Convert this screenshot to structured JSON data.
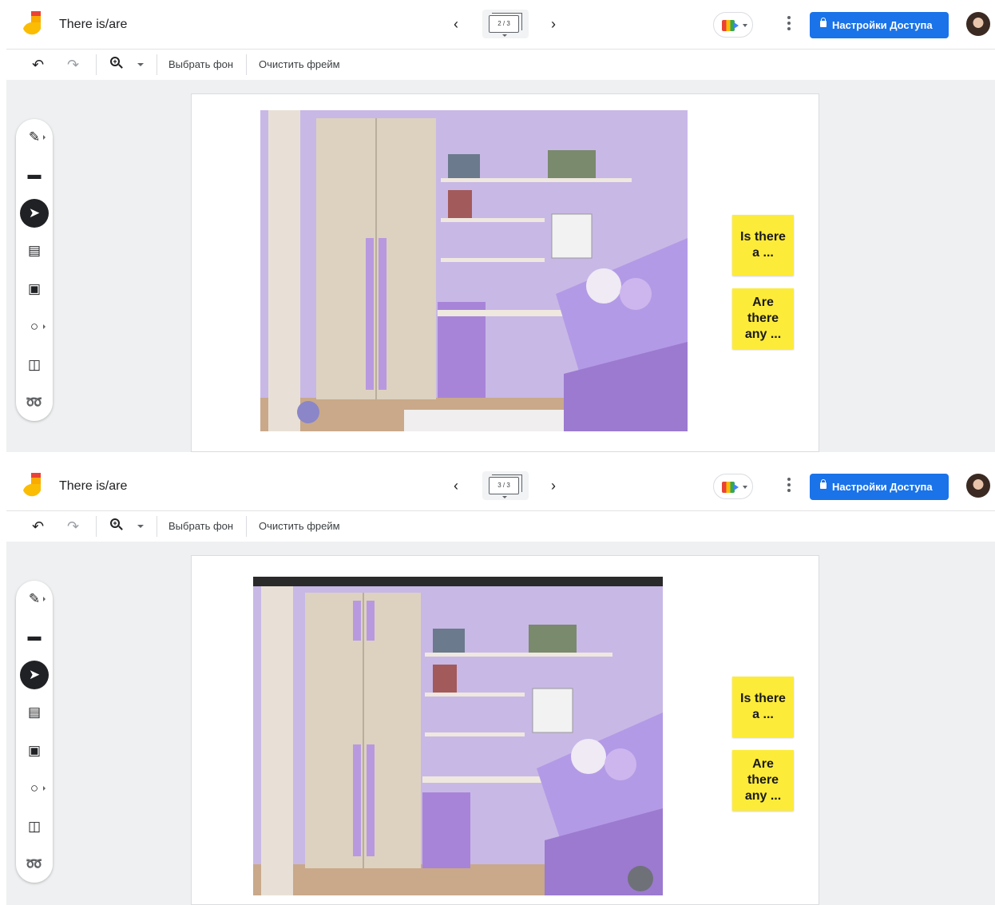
{
  "panels": [
    {
      "header": {
        "title": "There is/are",
        "frame_indicator": "2 / 3",
        "share_label": "Настройки Доступа"
      },
      "toolbar": {
        "choose_background": "Выбрать фон",
        "clear_frame": "Очистить фрейм"
      },
      "stickies": [
        "Is there a ...",
        "Are there any ..."
      ]
    },
    {
      "header": {
        "title": "There is/are",
        "frame_indicator": "3 / 3",
        "share_label": "Настройки Доступа"
      },
      "toolbar": {
        "choose_background": "Выбрать фон",
        "clear_frame": "Очистить фрейм"
      },
      "stickies": [
        "Is there a ...",
        "Are there any ..."
      ]
    }
  ],
  "tools": [
    "pen-icon",
    "eraser-icon",
    "select-icon",
    "sticky-note-icon",
    "image-icon",
    "circle-icon",
    "text-box-icon",
    "laser-icon"
  ],
  "colors": {
    "accent": "#1a73e8",
    "sticky": "#fdeb3a",
    "canvas_bg": "#eef0f1"
  }
}
